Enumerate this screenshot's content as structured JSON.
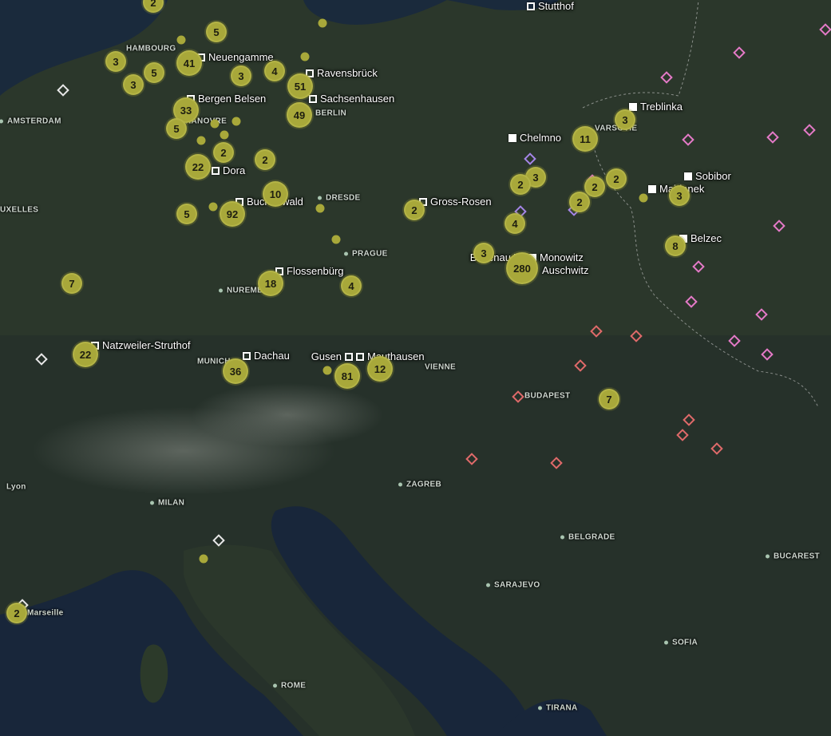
{
  "colors": {
    "cluster": "#a8a83a",
    "city_label": "#cfd8d0",
    "camp": "#ffffff",
    "pink": "#e57ac8",
    "red": "#e06a6a",
    "violet": "#a585e8"
  },
  "cities": {
    "hamburg": "HAMBOURG",
    "amsterdam": "AMSTERDAM",
    "hanovre": "HANOVRE",
    "berlin": "BERLIN",
    "varsovie": "VARSOVIE",
    "dresde": "DRESDE",
    "bruxelles": "UXELLES",
    "prague": "PRAGUE",
    "nuremberg": "NUREMBERG",
    "munich": "MUNICH",
    "vienne": "VIENNE",
    "budapest": "BUDAPEST",
    "lyon": "Lyon",
    "milan": "MILAN",
    "zagreb": "ZAGREB",
    "belgrade": "BELGRADE",
    "bucarest": "BUCAREST",
    "sarajevo": "SARAJEVO",
    "marseille": "Marseille",
    "sofia": "SOFIA",
    "rome": "ROME",
    "tirana": "TIRANA"
  },
  "camps": {
    "stutthof": "Stutthof",
    "neuengamme": "Neuengamme",
    "ravensbruck": "Ravensbrück",
    "bergen_belsen": "Bergen Belsen",
    "sachsenhausen": "Sachsenhausen",
    "treblinka": "Treblinka",
    "chelmno": "Chelmno",
    "dora": "Dora",
    "sobibor": "Sobibor",
    "majdanek": "Majdanek",
    "buchenwald": "Buchenwald",
    "gross_rosen": "Gross-Rosen",
    "belzec": "Belzec",
    "birkenau": "Birkenau",
    "monowitz": "Monowitz",
    "auschwitz": "Auschwitz",
    "flossenburg": "Flossenbürg",
    "natzweiler": "Natzweiler-Struthof",
    "dachau": "Dachau",
    "gusen": "Gusen",
    "mauthausen": "Mauthausen"
  },
  "clusters": [
    "2",
    "5",
    "3",
    "41",
    "3",
    "5",
    "3",
    "4",
    "51",
    "33",
    "49",
    "5",
    "2",
    "2",
    "22",
    "10",
    "5",
    "92",
    "2",
    "3",
    "2",
    "3",
    "2",
    "2",
    "11",
    "3",
    "2",
    "3",
    "4",
    "8",
    "3",
    "280",
    "7",
    "18",
    "4",
    "22",
    "36",
    "81",
    "12",
    "7",
    "2"
  ]
}
